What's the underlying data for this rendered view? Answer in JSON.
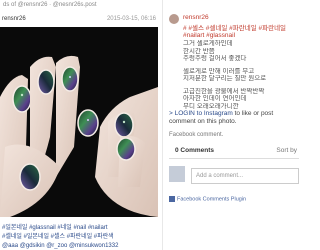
{
  "topbar": {
    "text": "ds of @rensnr26 · @nesnr26s.post"
  },
  "post": {
    "username": "rensnr26",
    "date": "2015-03-15, 06:16",
    "tags_line1": "#일본네일 #glassnail #네일 #nail #nailart",
    "tags_line2": "#셀네일 #일본네일 #셀스 #파란네일 #파란색",
    "mentions": "@aaa @gdsikin @r_zoo @minsukwon1332"
  },
  "caption": {
    "username": "rensnr26",
    "tags": "# #셀스 #셀네일 #파란네일 #파란네일",
    "hashtag_line": "#nailart #glassnail",
    "lines": [
      "그거 셀로게하인데",
      "한시간 반쯤",
      "주렁주렁 걸어서 좋겠다",
      "",
      "셀로게로 만해 이러를 무고",
      "지저분한 달구리는 칠만 원으로",
      "",
      "고급진한을 광물에서 반짝반짝",
      "아자한 인데이 연어인데",
      "무디 오래오래가니깐"
    ]
  },
  "login": {
    "link": "> LOGIN to Instagram",
    "rest": " to like or post comment on this photo."
  },
  "facebook": {
    "title": "Facebook comment.",
    "comments_count": "0 Comments",
    "sort_by": "Sort by",
    "placeholder": "Add a comment...",
    "plugin_label": "Facebook Comments Plugin"
  },
  "colors": {
    "accent_red": "#c0392b",
    "link_blue": "#2a4a8a",
    "fb_blue": "#4b67a1"
  }
}
